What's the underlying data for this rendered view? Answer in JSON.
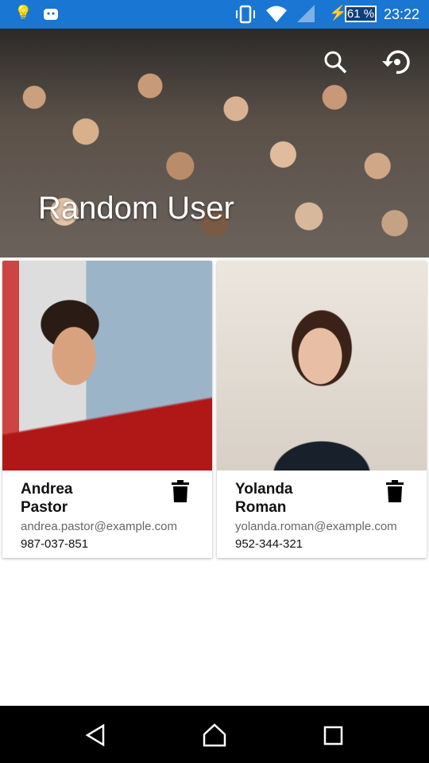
{
  "status_bar": {
    "time": "23:22",
    "battery": "61 %",
    "icons": [
      "lightbulb-icon",
      "android-icon",
      "vibrate-icon",
      "wifi-icon",
      "signal-icon",
      "charging-icon",
      "battery-icon"
    ]
  },
  "header": {
    "title": "Random User",
    "icons": [
      "search-icon",
      "restore-icon"
    ]
  },
  "users": [
    {
      "first": "Andrea",
      "last": "Pastor",
      "email": "andrea.pastor@example.com",
      "phone": "987-037-851"
    },
    {
      "first": "Yolanda",
      "last": "Roman",
      "email": "yolanda.roman@example.com",
      "phone": "952-344-321"
    }
  ],
  "nav": [
    "back-icon",
    "home-icon",
    "recents-icon"
  ],
  "colors": {
    "status_bar": "#1976d2",
    "nav_bar": "#000000"
  }
}
